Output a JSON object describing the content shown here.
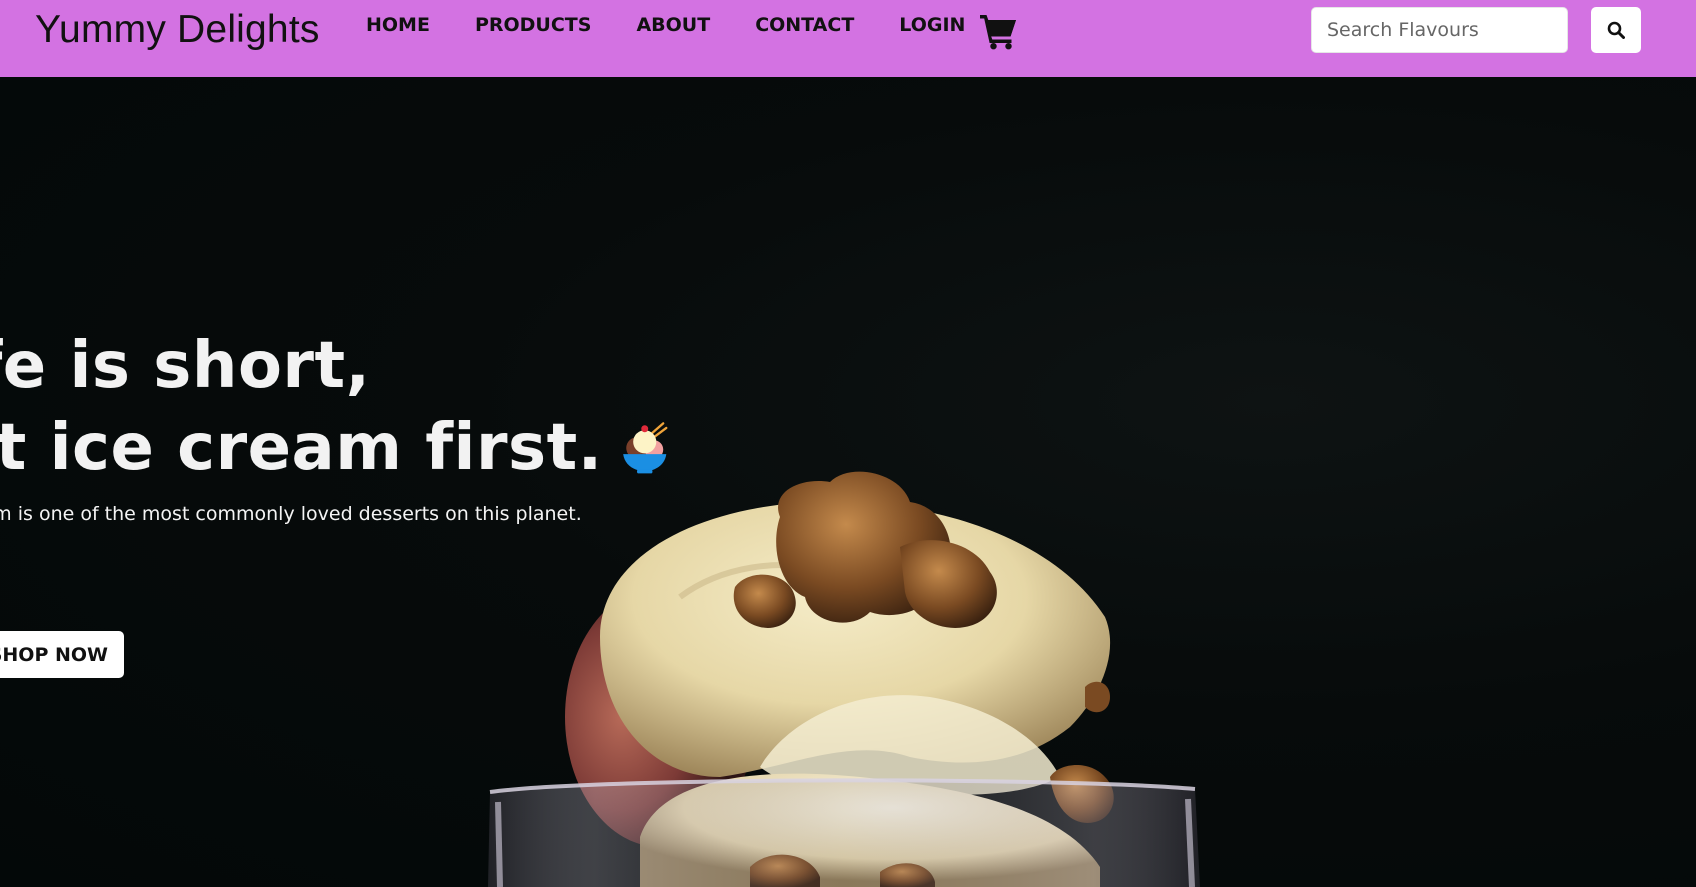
{
  "colors": {
    "navbar_bg": "#d372e2",
    "hero_bg": "#040d0d",
    "text_light": "#f2f2f2",
    "button_bg": "#ffffff"
  },
  "navbar": {
    "brand": "Yummy Delights",
    "links": [
      "HOME",
      "PRODUCTS",
      "ABOUT",
      "CONTACT",
      "LOGIN"
    ],
    "cart_icon": "shopping-cart-icon",
    "search": {
      "placeholder": "Search Flavours",
      "value": "",
      "button_icon": "search-icon"
    }
  },
  "hero": {
    "headline_line1": "ife is short,",
    "headline_line2": "at ice cream first.",
    "headline_emoji": "sundae-icon",
    "subtext": " cream is one of the most commonly loved desserts on this planet.",
    "cta_label": "SHOP NOW",
    "background_image": "ice-cream-sundae-photo"
  }
}
